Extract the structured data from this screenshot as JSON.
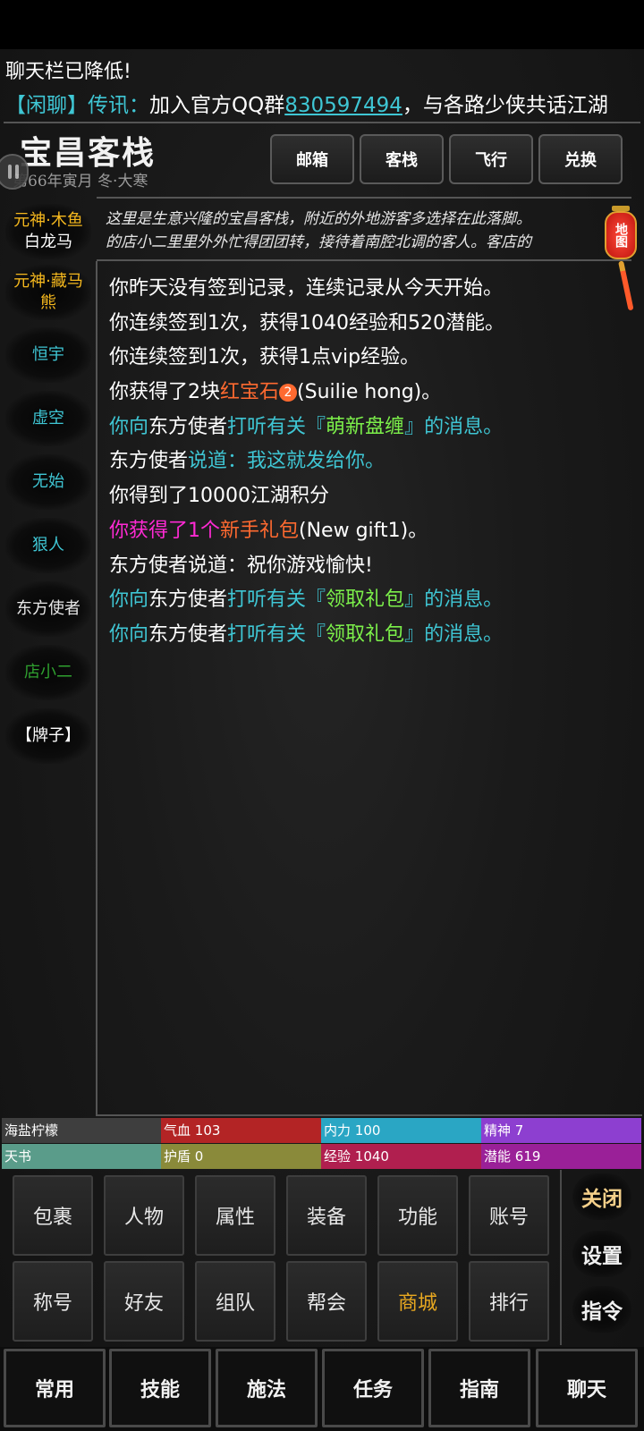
{
  "header": {
    "system_message": "聊天栏已降低!",
    "chat": {
      "tag": "【闲聊】",
      "speaker": "传讯：",
      "text_before": "加入官方QQ群",
      "group_number": "830597494",
      "text_after": "，与各路少侠共话江湖"
    }
  },
  "location": {
    "title": "宝昌客栈",
    "date": "第66年寅月  冬·大寒",
    "buttons": [
      "邮箱",
      "客栈",
      "飞行",
      "兑换"
    ],
    "description_line1": "这里是生意兴隆的宝昌客栈，附近的外地游客多选择在此落脚。",
    "description_line2": "的店小二里里外外忙得团团转，接待着南腔北调的客人。客店的",
    "map_label": "地图"
  },
  "npcs": [
    {
      "line1": "元神·木鱼",
      "line2": "白龙马",
      "color": "#f5b81e",
      "color2": "#ffffff"
    },
    {
      "line1": "元神·藏马",
      "line2": "熊",
      "color": "#f5b81e",
      "color2": "#f5b81e"
    },
    {
      "line1": "恒宇",
      "line2": "",
      "color": "#3fc6d4",
      "color2": ""
    },
    {
      "line1": "虚空",
      "line2": "",
      "color": "#3fc6d4",
      "color2": ""
    },
    {
      "line1": "无始",
      "line2": "",
      "color": "#3fc6d4",
      "color2": ""
    },
    {
      "line1": "狠人",
      "line2": "",
      "color": "#3fc6d4",
      "color2": ""
    },
    {
      "line1": "东方使者",
      "line2": "",
      "color": "#e8e8e8",
      "color2": ""
    },
    {
      "line1": "店小二",
      "line2": "",
      "color": "#2fa02f",
      "color2": ""
    },
    {
      "line1": "【牌子】",
      "line2": "",
      "color": "#ffffff",
      "color2": ""
    }
  ],
  "log": {
    "l1": "你昨天没有签到记录，连续记录从今天开始。",
    "l2": "你连续签到1次，获得1040经验和520潜能。",
    "l3": "你连续签到1次，获得1点vip经验。",
    "l4a": "你获得了2块",
    "l4b": "红宝石",
    "l4badge": "2",
    "l4c": "(Suilie hong)。",
    "l5a": "你向",
    "l5b": "东方使者",
    "l5c": "打听有关『",
    "l5d": "萌新盘缠",
    "l5e": "』的消息。",
    "l6a": "东方使者",
    "l6b": "说道：我这就发给你。",
    "l7": "你得到了10000江湖积分",
    "l8a": "你获得了1个",
    "l8b": "新手礼包",
    "l8c": "(New gift1)。",
    "l9a": "东方使者",
    "l9b": "说道：祝你游戏愉快!",
    "l10a": "你向",
    "l10b": "东方使者",
    "l10c": "打听有关『",
    "l10d": "领取礼包",
    "l10e": "』的消息。",
    "l11a": "你向",
    "l11b": "东方使者",
    "l11c": "打听有关『",
    "l11d": "领取礼包",
    "l11e": "』的消息。"
  },
  "stats": {
    "name": "海盐柠檬",
    "hp_label": "气血",
    "hp": "103",
    "mp_label": "内力",
    "mp": "100",
    "spirit_label": "精神",
    "spirit": "7",
    "book": "天书",
    "shield_label": "护盾",
    "shield": "0",
    "exp_label": "经验",
    "exp": "1040",
    "potential_label": "潜能",
    "potential": "619",
    "colors": {
      "name": "#3e3e3e",
      "hp": "#b32425",
      "mp": "#2aa6c4",
      "spirit": "#8d3fd0",
      "book": "#5a9c8a",
      "shield": "#8a8a3a",
      "exp": "#b01f4f",
      "potential": "#9a2098"
    }
  },
  "menu": {
    "row1": [
      "包裹",
      "人物",
      "属性",
      "装备",
      "功能",
      "账号"
    ],
    "row2": [
      "称号",
      "好友",
      "组队",
      "帮会",
      "商城",
      "排行"
    ],
    "highlight_color": "#e8a820"
  },
  "side": [
    "关闭",
    "设置",
    "指令"
  ],
  "tabs": [
    "常用",
    "技能",
    "施法",
    "任务",
    "指南",
    "聊天"
  ]
}
